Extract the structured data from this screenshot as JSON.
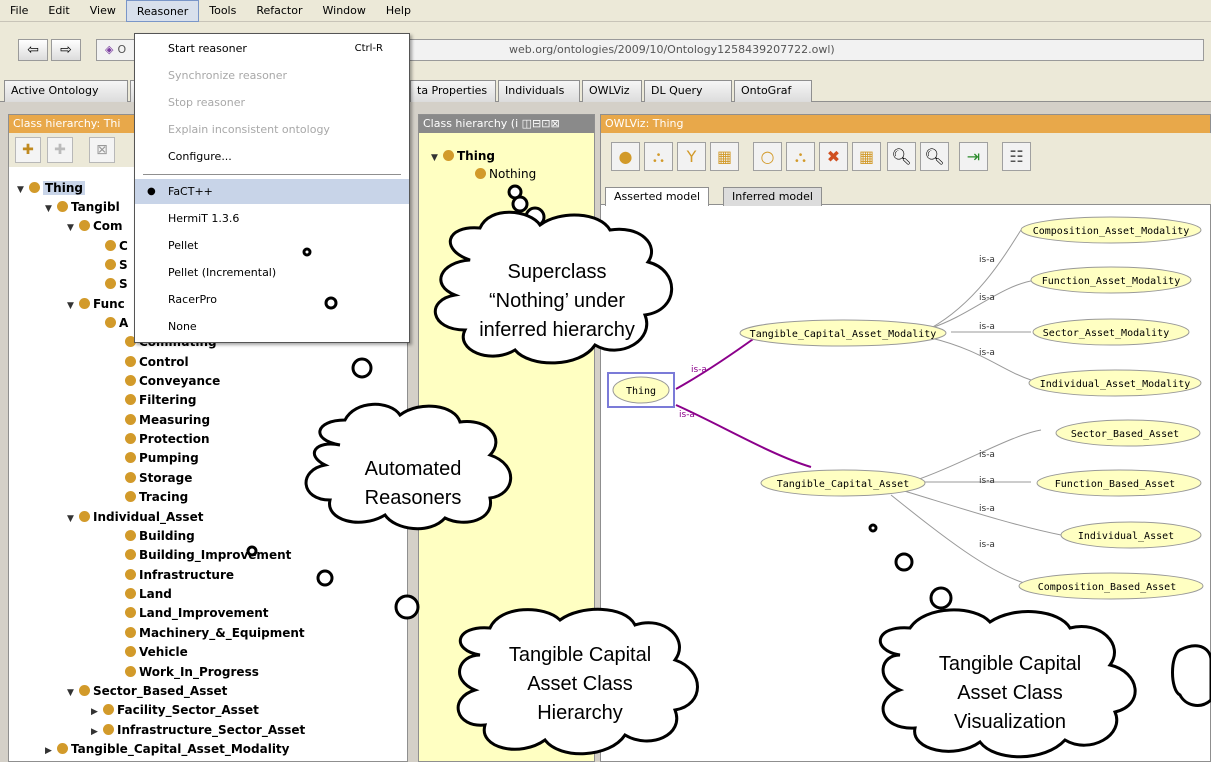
{
  "menubar": {
    "items": [
      "File",
      "Edit",
      "View",
      "Reasoner",
      "Tools",
      "Refactor",
      "Window",
      "Help"
    ],
    "active": "Reasoner"
  },
  "toolbar": {
    "back_glyph": "⇦",
    "forward_glyph": "⇨",
    "ontology_prefix": "O",
    "ontology_iri": "web.org/ontologies/2009/10/Ontology1258439207722.owl)"
  },
  "tabs": [
    "Active Ontology",
    "",
    "ta Properties",
    "Individuals",
    "OWLViz",
    "DL Query",
    "OntoGraf"
  ],
  "reasoner_menu": {
    "items": [
      {
        "label": "Start reasoner",
        "shortcut": "Ctrl-R",
        "state": "enabled"
      },
      {
        "label": "Synchronize reasoner",
        "state": "disabled"
      },
      {
        "label": "Stop reasoner",
        "state": "disabled"
      },
      {
        "label": "Explain inconsistent ontology",
        "state": "disabled"
      },
      {
        "label": "Configure...",
        "state": "enabled"
      },
      {
        "label": "FaCT++",
        "state": "selected"
      },
      {
        "label": "HermiT 1.3.6",
        "state": "enabled"
      },
      {
        "label": "Pellet",
        "state": "enabled"
      },
      {
        "label": "Pellet (Incremental)",
        "state": "enabled"
      },
      {
        "label": "RacerPro",
        "state": "enabled"
      },
      {
        "label": "None",
        "state": "enabled"
      }
    ]
  },
  "left_panel": {
    "header": "Class hierarchy: Thi",
    "tree": [
      {
        "label": "Thing",
        "expanded": true
      },
      {
        "label": "Tangibl",
        "expanded": true
      },
      {
        "label": "Com",
        "expanded": true
      },
      {
        "label": "C"
      },
      {
        "label": "S"
      },
      {
        "label": "S"
      },
      {
        "label": "Func",
        "expanded": true
      },
      {
        "label": "A"
      },
      {
        "label": "Commuting"
      },
      {
        "label": "Control"
      },
      {
        "label": "Conveyance"
      },
      {
        "label": "Filtering"
      },
      {
        "label": "Measuring"
      },
      {
        "label": "Protection"
      },
      {
        "label": "Pumping"
      },
      {
        "label": "Storage"
      },
      {
        "label": "Tracing"
      },
      {
        "label": "Individual_Asset",
        "expanded": true
      },
      {
        "label": "Building"
      },
      {
        "label": "Building_Improvement"
      },
      {
        "label": "Infrastructure"
      },
      {
        "label": "Land"
      },
      {
        "label": "Land_Improvement"
      },
      {
        "label": "Machinery_&_Equipment"
      },
      {
        "label": "Vehicle"
      },
      {
        "label": "Work_In_Progress"
      },
      {
        "label": "Sector_Based_Asset",
        "expanded": true
      },
      {
        "label": "Facility_Sector_Asset",
        "expanded": false
      },
      {
        "label": "Infrastructure_Sector_Asset",
        "expanded": false
      },
      {
        "label": "Tangible_Capital_Asset_Modality",
        "expanded": false
      }
    ]
  },
  "mid_panel": {
    "header": "Class hierarchy (i",
    "tree": [
      "Thing",
      "Nothing"
    ]
  },
  "right_panel": {
    "header": "OWLViz: Thing",
    "tabs": [
      "Asserted model",
      "Inferred model"
    ],
    "graph": {
      "nodes": [
        "Thing",
        "Tangible_Capital_Asset_Modality",
        "Tangible_Capital_Asset",
        "Composition_Asset_Modality",
        "Function_Asset_Modality",
        "Sector_Asset_Modality",
        "Individual_Asset_Modality",
        "Sector_Based_Asset",
        "Function_Based_Asset",
        "Individual_Asset",
        "Composition_Based_Asset"
      ],
      "edge_label": "is-a"
    }
  },
  "callouts": {
    "superclass": [
      "Superclass",
      "“Nothing’ under",
      "inferred hierarchy"
    ],
    "reasoners": [
      "Automated",
      "Reasoners"
    ],
    "hierarchy": [
      "Tangible Capital",
      "Asset Class",
      "Hierarchy"
    ],
    "visualization": [
      "Tangible Capital",
      "Asset Class",
      "Visualization"
    ]
  },
  "colors": {
    "node_fill": "#ffffc2",
    "class_dot": "#d29a2a",
    "panel_header": "#e8a84a",
    "inferred_edge": "#8b008b",
    "menu_highlight": "#c8d4e8"
  }
}
